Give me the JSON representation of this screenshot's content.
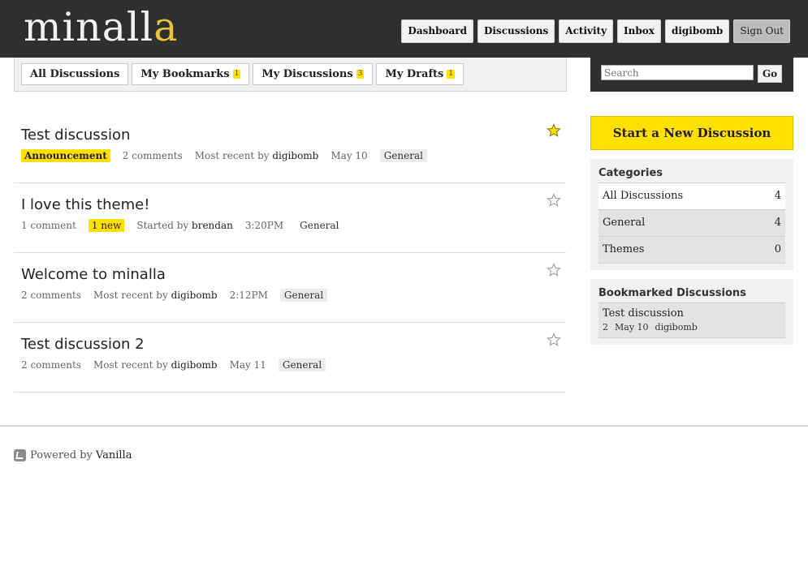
{
  "app": {
    "logo_main": "minall",
    "logo_accent": "a"
  },
  "topnav": [
    {
      "label": "Dashboard"
    },
    {
      "label": "Discussions"
    },
    {
      "label": "Activity"
    },
    {
      "label": "Inbox"
    },
    {
      "label": "digibomb"
    },
    {
      "label": "Sign Out"
    }
  ],
  "tabs": [
    {
      "label": "All Discussions",
      "count": ""
    },
    {
      "label": "My Bookmarks",
      "count": "1"
    },
    {
      "label": "My Discussions",
      "count": "3"
    },
    {
      "label": "My Drafts",
      "count": "1"
    }
  ],
  "discussions": [
    {
      "title": "Test discussion",
      "badge": "Announcement",
      "comments": "2 comments",
      "activity_prefix": "Most recent by",
      "user": "digibomb",
      "time": "May 10",
      "category": "General",
      "bookmarked": true
    },
    {
      "title": "I love this theme!",
      "comments": "1 comment",
      "new_badge": "1 new",
      "activity_prefix": "Started by",
      "user": "brendan",
      "time": "3:20PM",
      "category": "General",
      "bookmarked": false
    },
    {
      "title": "Welcome to minalla",
      "comments": "2 comments",
      "activity_prefix": "Most recent by",
      "user": "digibomb",
      "time": "2:12PM",
      "category": "General",
      "bookmarked": false
    },
    {
      "title": "Test discussion 2",
      "comments": "2 comments",
      "activity_prefix": "Most recent by",
      "user": "digibomb",
      "time": "May 11",
      "category": "General",
      "bookmarked": false
    }
  ],
  "search": {
    "placeholder": "Search",
    "button": "Go"
  },
  "new_discussion": "Start a New Discussion",
  "categories": {
    "heading": "Categories",
    "items": [
      {
        "label": "All Discussions",
        "count": "4"
      },
      {
        "label": "General",
        "count": "4"
      },
      {
        "label": "Themes",
        "count": "0"
      }
    ]
  },
  "bookmarked": {
    "heading": "Bookmarked Discussions",
    "items": [
      {
        "title": "Test discussion",
        "count": "2",
        "date": "May 10",
        "user": "digibomb"
      }
    ]
  },
  "footer": {
    "powered_by": "Powered by",
    "link": "Vanilla"
  },
  "colors": {
    "accent": "#ffe000",
    "header_bg": "#2f2f2f",
    "logo_accent": "#e8c33b"
  }
}
